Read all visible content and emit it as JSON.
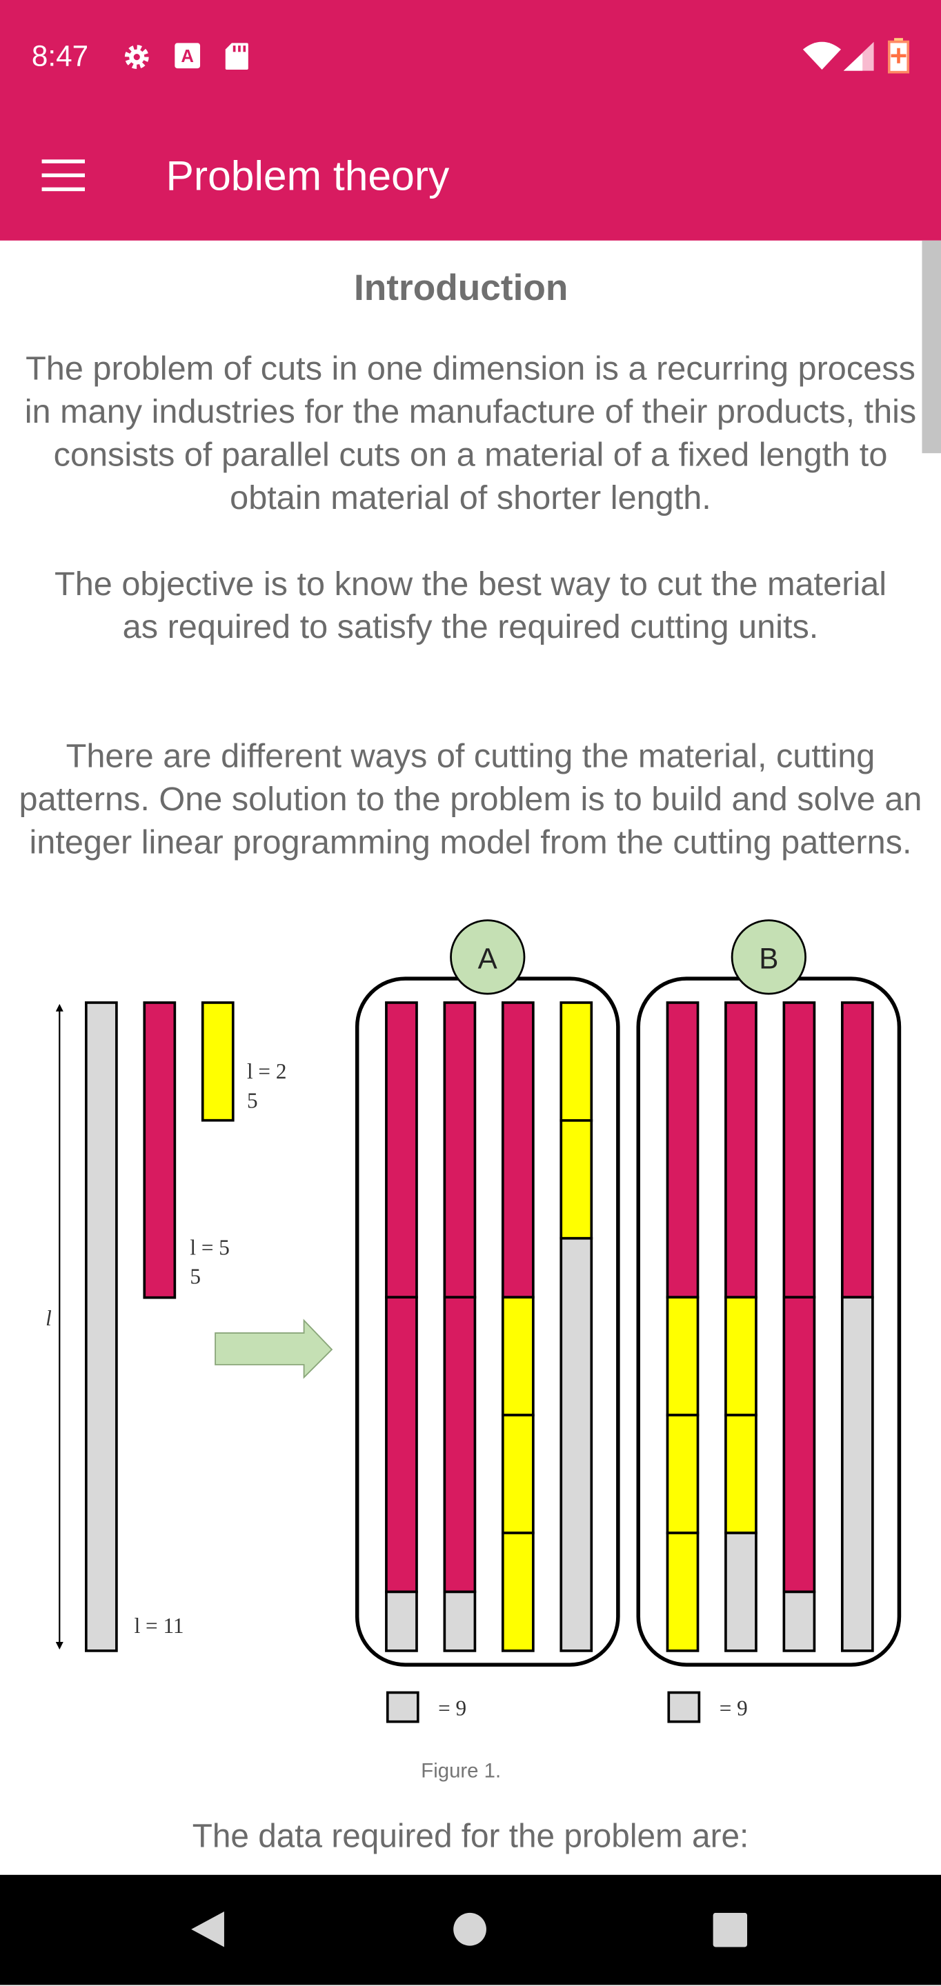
{
  "status_bar": {
    "time": "8:47",
    "left_icons": [
      "gear-icon",
      "font-a-icon",
      "sd-card-icon"
    ],
    "right_icons": [
      "wifi-icon",
      "signal-icon",
      "battery-charging-icon"
    ]
  },
  "toolbar": {
    "title": "Problem theory",
    "menu_icon": "hamburger-menu-icon"
  },
  "colors": {
    "primary": "#d81b60",
    "pink_piece": "#d81b60",
    "yellow_piece": "#ffff00",
    "waste": "#d9d9d9",
    "arrow": "#c5e0b4",
    "circle": "#c5e0b4"
  },
  "content": {
    "heading": "Introduction",
    "paragraphs": [
      "The problem of cuts in one dimension is a recurring process in many industries for the manufacture of their products, this consists of parallel cuts on a material of a fixed length to obtain material of shorter length.",
      "The objective is to know the best way to cut the material as required to satisfy the required cutting units.",
      "There are different ways of cutting the material, cutting patterns. One solution to the problem is to build and solve an integer linear programming model from the cutting patterns."
    ],
    "figure": {
      "length_label": "l",
      "stock_label": "l = 11",
      "piece_pink_label": [
        "l = 5",
        "5"
      ],
      "piece_yellow_label": [
        "l = 2",
        "5"
      ],
      "stock_length": 11,
      "patterns": [
        {
          "name": "A",
          "bars": [
            [
              [
                "p",
                5
              ],
              [
                "p",
                5
              ],
              [
                "w",
                1
              ]
            ],
            [
              [
                "p",
                5
              ],
              [
                "p",
                5
              ],
              [
                "w",
                1
              ]
            ],
            [
              [
                "p",
                5
              ],
              [
                "y",
                2
              ],
              [
                "y",
                2
              ],
              [
                "y",
                2
              ]
            ],
            [
              [
                "y",
                2
              ],
              [
                "y",
                2
              ],
              [
                "w",
                7
              ]
            ]
          ],
          "legend": "= 9"
        },
        {
          "name": "B",
          "bars": [
            [
              [
                "p",
                5
              ],
              [
                "y",
                2
              ],
              [
                "y",
                2
              ],
              [
                "y",
                2
              ]
            ],
            [
              [
                "p",
                5
              ],
              [
                "y",
                2
              ],
              [
                "y",
                2
              ],
              [
                "w",
                2
              ]
            ],
            [
              [
                "p",
                5
              ],
              [
                "p",
                5
              ],
              [
                "w",
                1
              ]
            ],
            [
              [
                "p",
                5
              ],
              [
                "w",
                6
              ]
            ]
          ],
          "legend": "= 9"
        }
      ],
      "caption": "Figure 1."
    },
    "footer_text": "The data required for the problem are:"
  },
  "nav_bar": {
    "buttons": [
      "back-icon",
      "home-icon",
      "recents-icon"
    ]
  }
}
